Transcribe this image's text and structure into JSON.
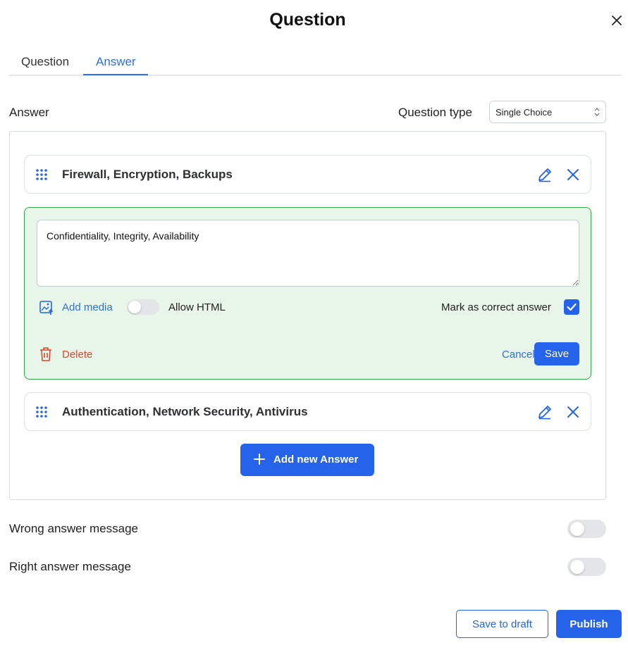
{
  "modal": {
    "title": "Question",
    "close_icon": "close-icon"
  },
  "tabs": [
    {
      "label": "Question",
      "active": false
    },
    {
      "label": "Answer",
      "active": true
    }
  ],
  "answer_section": {
    "label": "Answer",
    "question_type_label": "Question type",
    "question_type_value": "Single Choice"
  },
  "answers": [
    {
      "text": "Firewall, Encryption, Backups",
      "state": "collapsed"
    },
    {
      "text": "Confidentiality, Integrity, Availability",
      "state": "editing",
      "add_media_label": "Add media",
      "allow_html_label": "Allow HTML",
      "allow_html_on": false,
      "mark_correct_label": "Mark as correct answer",
      "is_correct": true,
      "delete_label": "Delete",
      "cancel_label": "Cancel",
      "save_label": "Save"
    },
    {
      "text": "Authentication, Network Security, Antivirus",
      "state": "collapsed"
    }
  ],
  "add_answer_label": "Add new Answer",
  "messages": {
    "wrong_label": "Wrong answer message",
    "wrong_on": false,
    "right_label": "Right answer message",
    "right_on": false
  },
  "footer": {
    "draft_label": "Save to draft",
    "publish_label": "Publish"
  },
  "colors": {
    "accent": "#2563eb",
    "correct_bg": "#e7f6e8",
    "correct_border": "#2fa94a",
    "danger": "#e0452e"
  }
}
